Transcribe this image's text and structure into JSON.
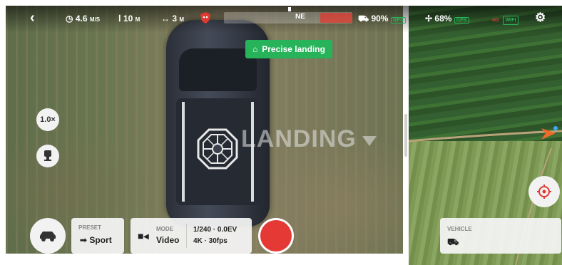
{
  "top_bar": {
    "back_icon": "chevron-left-icon",
    "speed": "4.6",
    "speed_unit": "M/S",
    "height": "10",
    "height_unit": "M",
    "distance": "3",
    "distance_unit": "M",
    "heading": "NE",
    "vehicle_battery": "90%",
    "gps_badge": "GPS",
    "drone_battery": "68%",
    "gps_badge_2": "GPS",
    "network": "4G",
    "wifi": "WIFI",
    "settings_icon": "gear-icon"
  },
  "banner": {
    "label": "Precise landing"
  },
  "overlay": {
    "landing_text": "LANDING"
  },
  "left_controls": {
    "zoom": "1.0×"
  },
  "bottom_bar": {
    "preset_label": "PRESET",
    "preset_value": "Sport",
    "mode_label": "MODE",
    "mode_value": "Video",
    "exposure": "1/240 · 0.0EV",
    "resolution": "4K · 30fps"
  },
  "map_panel": {
    "vehicle_label": "VEHICLE"
  },
  "colors": {
    "accent_green": "#26b35a",
    "record_red": "#e53935",
    "alert_red": "#e0392f"
  }
}
